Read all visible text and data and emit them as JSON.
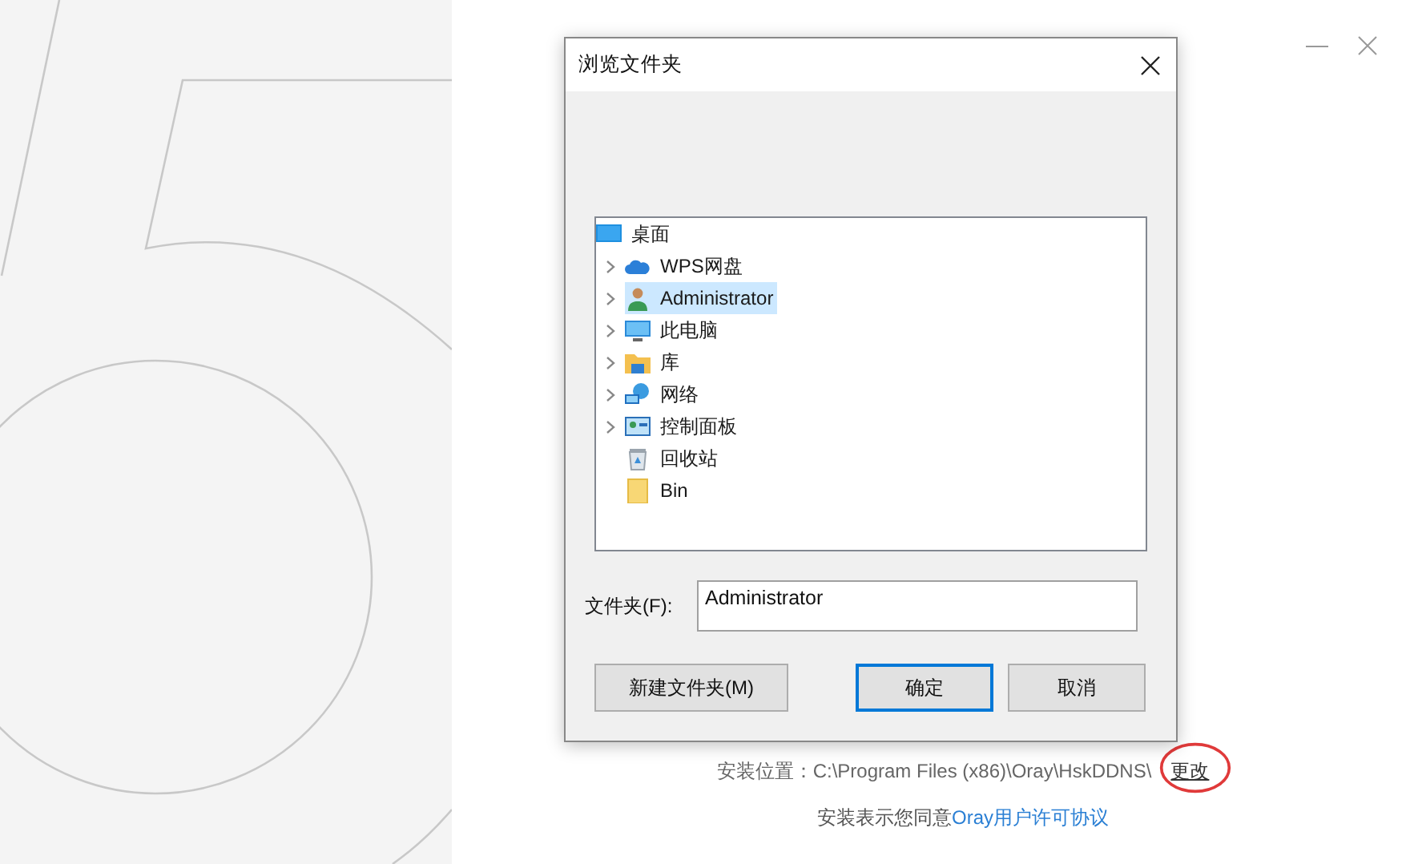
{
  "installer": {
    "location_label": "安装位置：C:\\Program Files (x86)\\Oray\\HskDDNS\\",
    "change_link": "更改",
    "agreement_text": "安装表示您同意",
    "agreement_link": "Oray用户许可协议"
  },
  "dialog": {
    "title": "浏览文件夹",
    "tree": [
      {
        "label": "桌面",
        "kind": "desktop",
        "expandable": false,
        "selected": false,
        "children": [
          {
            "label": "WPS网盘",
            "kind": "cloud",
            "expandable": true,
            "selected": false
          },
          {
            "label": "Administrator",
            "kind": "user",
            "expandable": true,
            "selected": true
          },
          {
            "label": "此电脑",
            "kind": "computer",
            "expandable": true,
            "selected": false
          },
          {
            "label": "库",
            "kind": "library",
            "expandable": true,
            "selected": false
          },
          {
            "label": "网络",
            "kind": "network",
            "expandable": true,
            "selected": false
          },
          {
            "label": "控制面板",
            "kind": "control-panel",
            "expandable": true,
            "selected": false
          },
          {
            "label": "回收站",
            "kind": "recycle-bin",
            "expandable": false,
            "selected": false
          },
          {
            "label": "Bin",
            "kind": "folder",
            "expandable": false,
            "selected": false
          }
        ]
      }
    ],
    "folder_label": "文件夹(F):",
    "folder_value": "Administrator",
    "buttons": [
      {
        "label": "新建文件夹(M)",
        "default": false
      },
      {
        "label": "确定",
        "default": true
      },
      {
        "label": "取消",
        "default": false
      }
    ]
  }
}
